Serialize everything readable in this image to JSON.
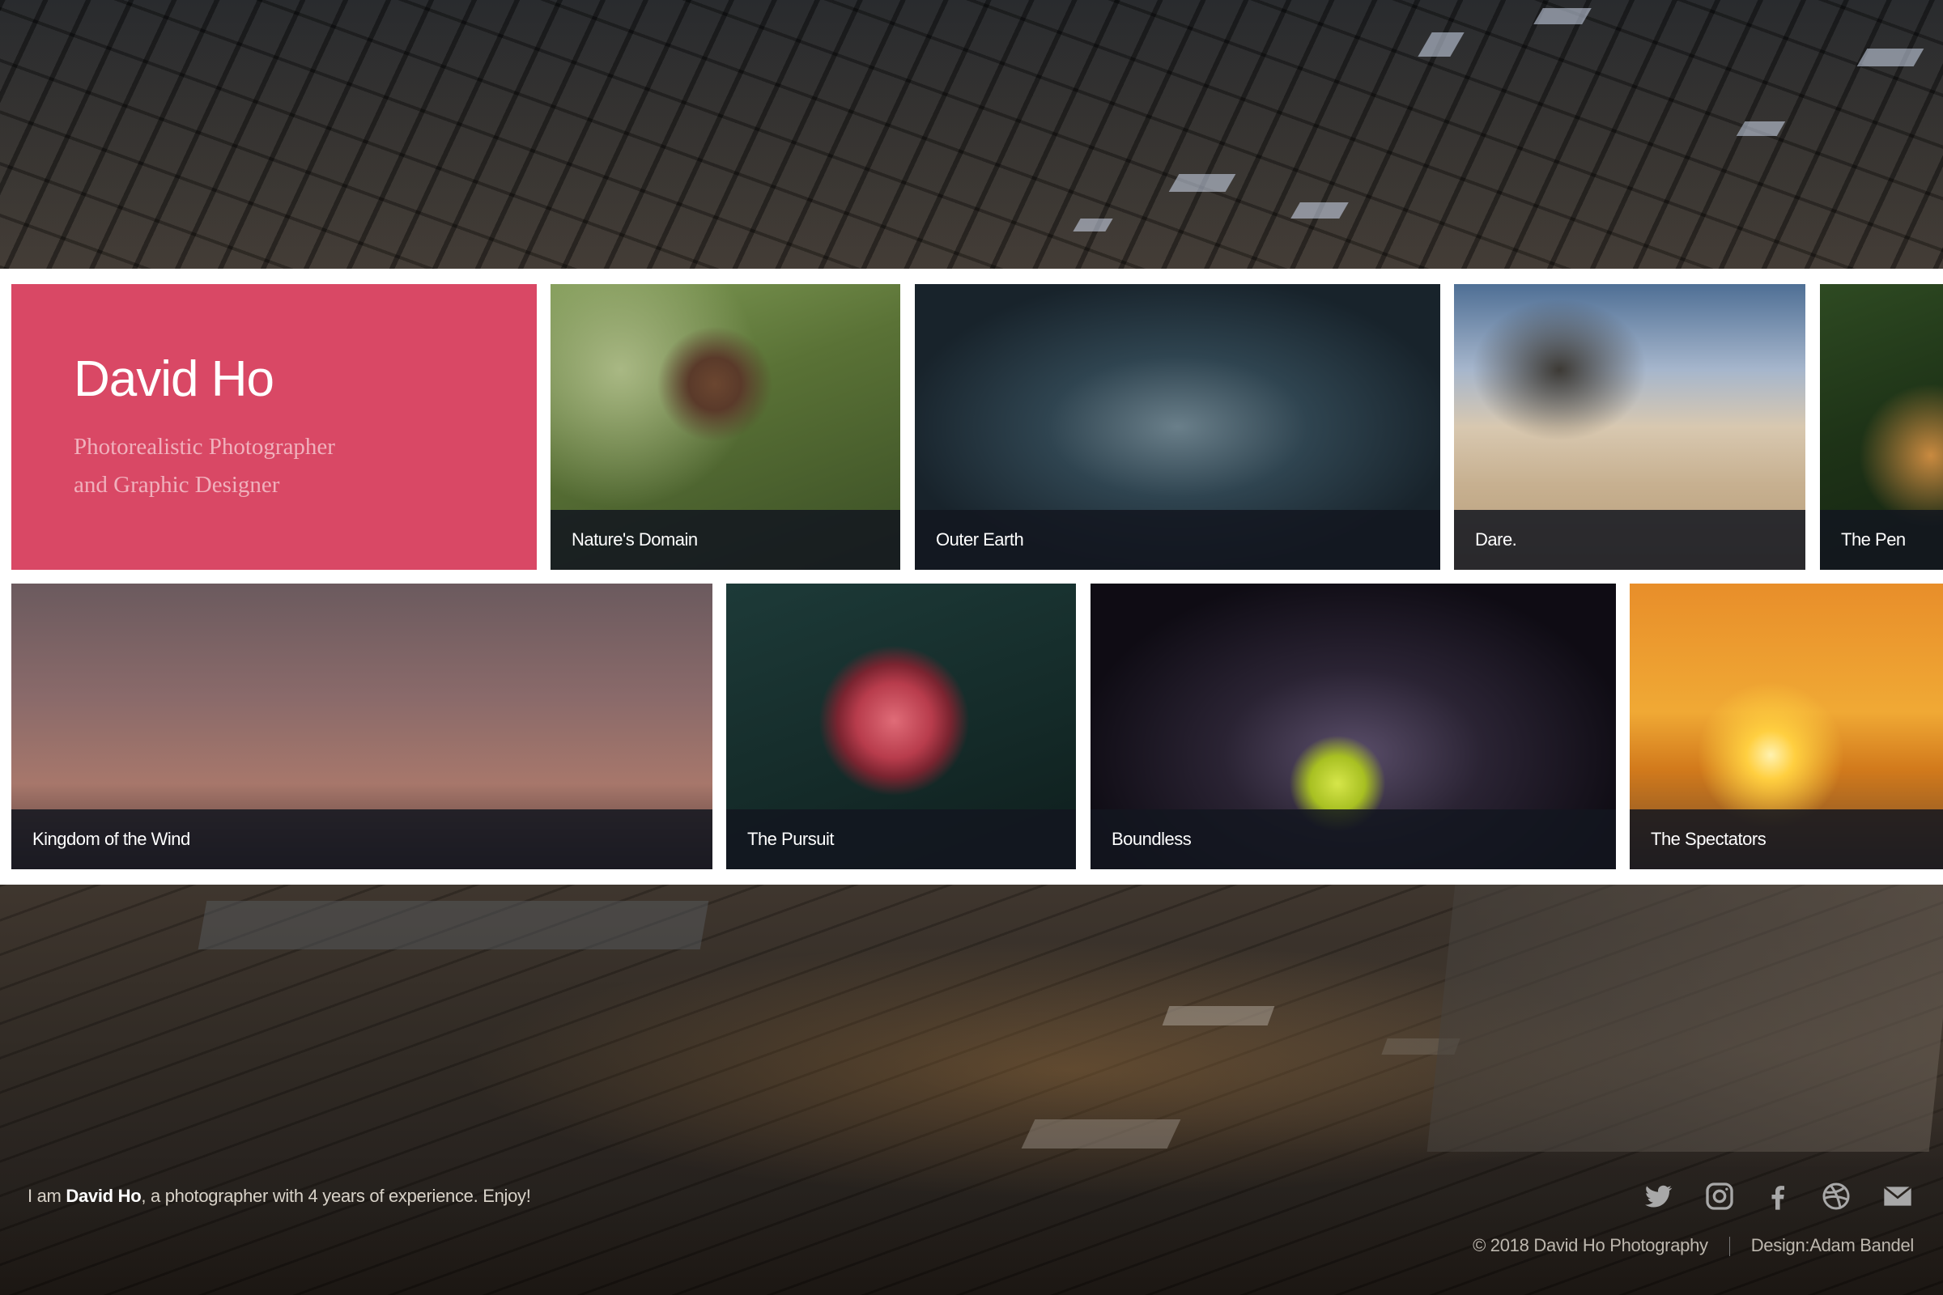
{
  "intro": {
    "name": "David Ho",
    "role_line1": "Photorealistic Photographer",
    "role_line2": "and Graphic Designer"
  },
  "gallery": {
    "row1": [
      {
        "title": "Nature's Domain"
      },
      {
        "title": "Outer Earth"
      },
      {
        "title": "Dare."
      },
      {
        "title": "The Pen"
      }
    ],
    "row2": [
      {
        "title": "Kingdom of the Wind"
      },
      {
        "title": "The Pursuit"
      },
      {
        "title": "Boundless"
      },
      {
        "title": "The Spectators"
      }
    ]
  },
  "footer": {
    "bio_prefix": "I am ",
    "bio_name": "David Ho",
    "bio_suffix": ", a photographer with 4 years of experience. Enjoy!",
    "copyright": "© 2018 David Ho Photography",
    "design_credit": "Design:Adam Bandel",
    "social_icons": [
      "twitter-icon",
      "instagram-icon",
      "facebook-icon",
      "dribbble-icon",
      "email-icon"
    ]
  },
  "colors": {
    "accent": "#d94865",
    "caption_bg": "#13161f",
    "gallery_bg": "#ffffff"
  }
}
